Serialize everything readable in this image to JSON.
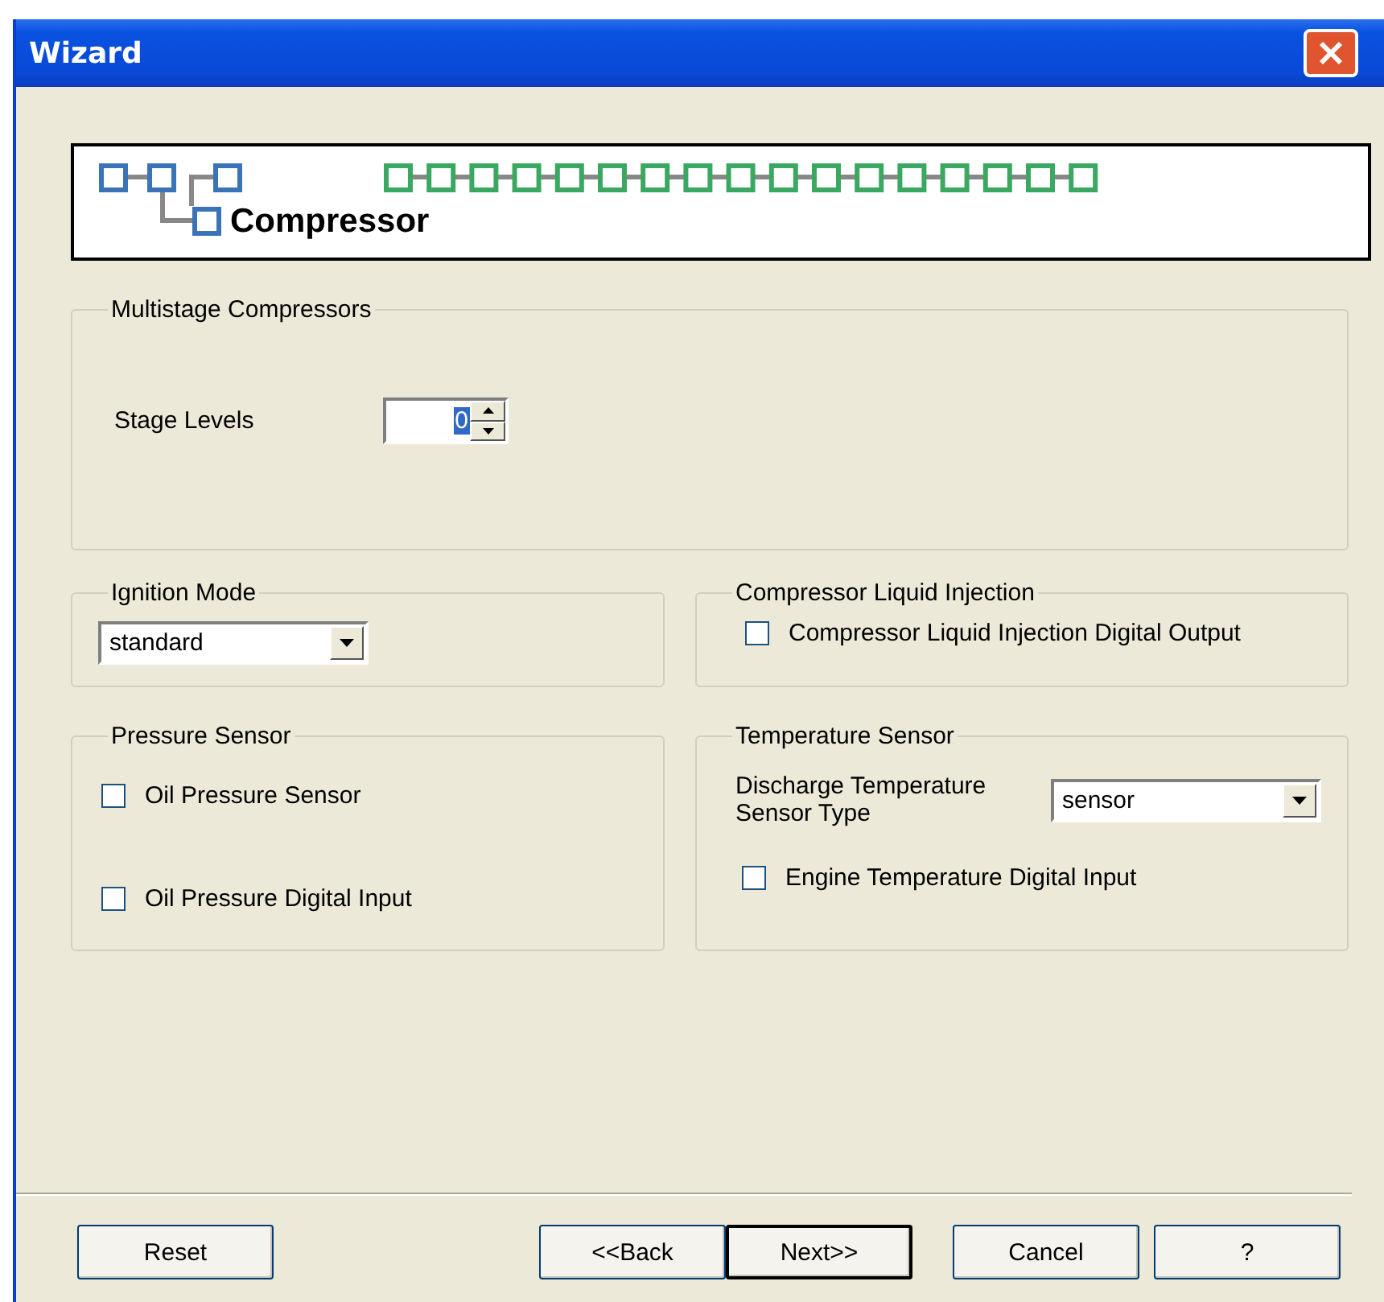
{
  "window": {
    "title": "Wizard"
  },
  "banner": {
    "title": "Compressor"
  },
  "multistage": {
    "legend": "Multistage Compressors",
    "stage_label": "Stage Levels",
    "stage_value": "0",
    "stage_value_focused": true
  },
  "ignition": {
    "legend": "Ignition Mode",
    "value": "standard"
  },
  "liquid_injection": {
    "legend": "Compressor Liquid Injection",
    "checkbox": {
      "label": "Compressor Liquid Injection Digital Output",
      "checked": false
    }
  },
  "pressure_sensor": {
    "legend": "Pressure Sensor",
    "checkboxes": [
      {
        "label": "Oil Pressure Sensor",
        "checked": false
      },
      {
        "label": "Oil Pressure Digital Input",
        "checked": false
      }
    ]
  },
  "temperature_sensor": {
    "legend": "Temperature Sensor",
    "type_label": "Discharge Temperature Sensor Type",
    "type_value": "sensor",
    "checkbox": {
      "label": "Engine Temperature Digital Input",
      "checked": false
    }
  },
  "buttons": [
    {
      "label": "Reset",
      "default": false
    },
    {
      "label": "<<Back",
      "default": false
    },
    {
      "label": "Next>>",
      "default": true
    },
    {
      "label": "Cancel",
      "default": false
    },
    {
      "label": "?",
      "default": false
    }
  ]
}
